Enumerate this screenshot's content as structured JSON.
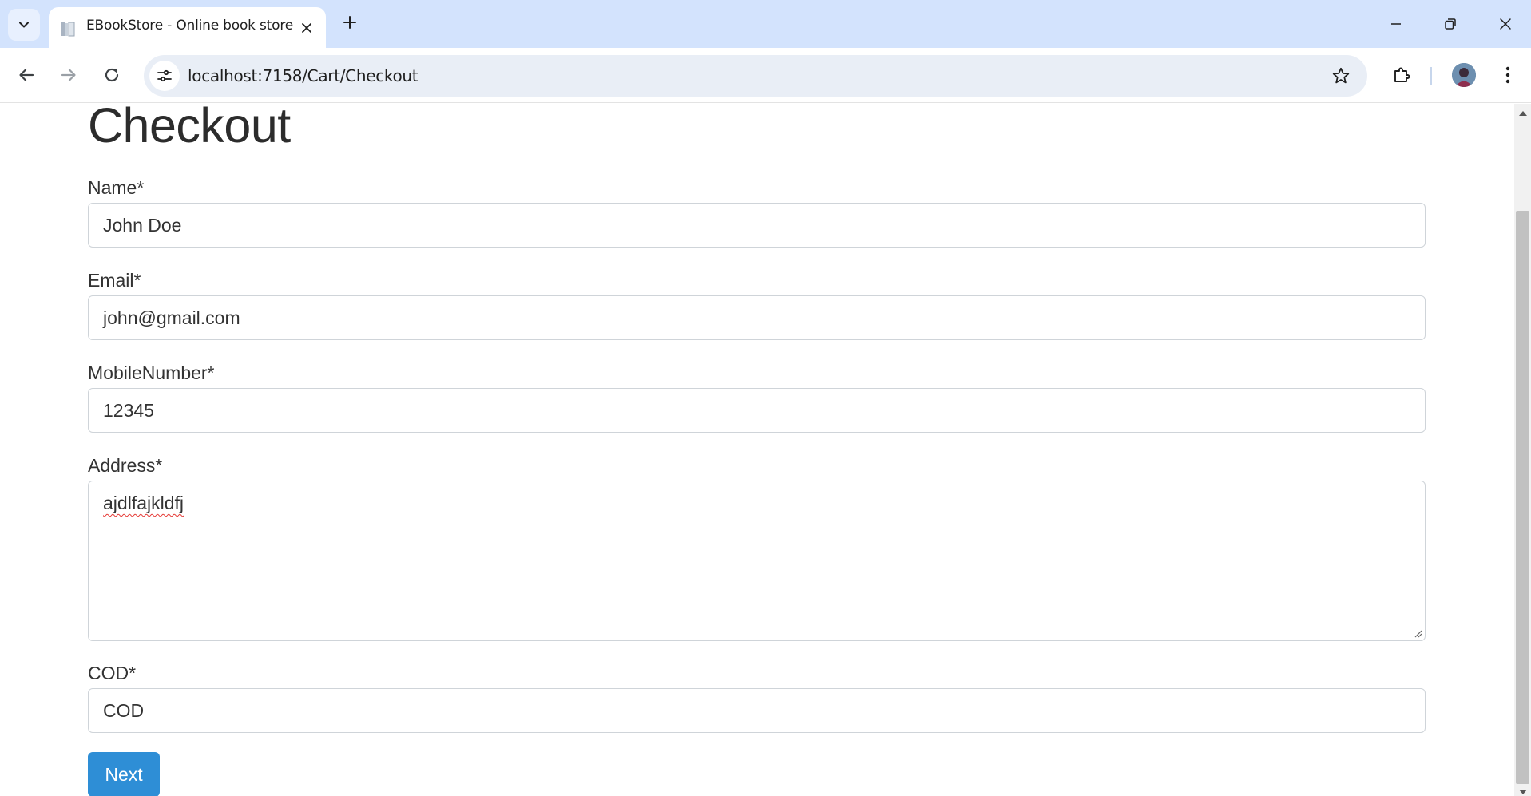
{
  "browser": {
    "tab_title": "EBookStore - Online book store",
    "url": "localhost:7158/Cart/Checkout",
    "icons": {
      "tab_search": "chevron-down-icon",
      "favicon": "book-favicon-icon",
      "tab_close": "close-icon",
      "new_tab": "plus-icon",
      "minimize": "minimize-icon",
      "restore": "restore-icon",
      "close_window": "close-icon",
      "back": "arrow-left-icon",
      "forward": "arrow-right-icon",
      "reload": "reload-icon",
      "site_info": "tune-icon",
      "bookmark": "star-icon",
      "extensions": "puzzle-icon",
      "menu": "kebab-menu-icon"
    },
    "colors": {
      "tabstrip": "#d3e3fd",
      "omnibox": "#e9eef6"
    }
  },
  "page": {
    "title": "Checkout",
    "fields": {
      "name": {
        "label": "Name*",
        "value": "John Doe"
      },
      "email": {
        "label": "Email*",
        "value": "john@gmail.com"
      },
      "mobile": {
        "label": "MobileNumber*",
        "value": "12345"
      },
      "address": {
        "label": "Address*",
        "value": "ajdlfajkldfj"
      },
      "cod": {
        "label": "COD*",
        "value": "COD"
      }
    },
    "next_button": "Next",
    "colors": {
      "primary": "#2e8ed6",
      "text": "#333333"
    }
  }
}
